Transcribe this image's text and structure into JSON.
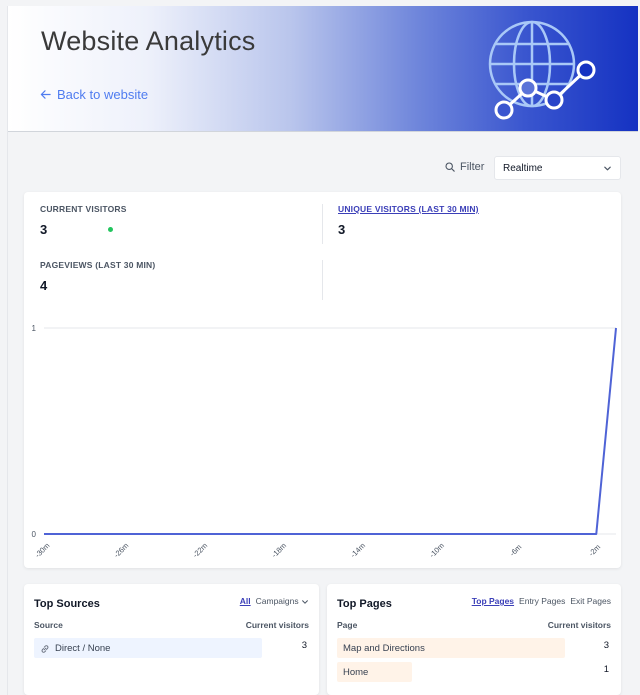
{
  "header": {
    "title": "Website Analytics",
    "back_link": "Back to website"
  },
  "controls": {
    "filter_label": "Filter",
    "period_selected": "Realtime"
  },
  "stats": [
    {
      "label": "CURRENT VISITORS",
      "value": "3",
      "selected": false
    },
    {
      "label": "UNIQUE VISITORS (LAST 30 MIN)",
      "value": "3",
      "selected": true
    },
    {
      "label": "PAGEVIEWS (LAST 30 MIN)",
      "value": "4",
      "selected": false
    }
  ],
  "chart_data": {
    "type": "line",
    "x": [
      -30,
      -29,
      -28,
      -27,
      -26,
      -25,
      -24,
      -23,
      -22,
      -21,
      -20,
      -19,
      -18,
      -17,
      -16,
      -15,
      -14,
      -13,
      -12,
      -11,
      -10,
      -9,
      -8,
      -7,
      -6,
      -5,
      -4,
      -3,
      -2,
      -1
    ],
    "x_tick_labels": [
      "-30m",
      "-26m",
      "-22m",
      "-18m",
      "-14m",
      "-10m",
      "-6m",
      "-2m"
    ],
    "series": [
      {
        "values": [
          0,
          0,
          0,
          0,
          0,
          0,
          0,
          0,
          0,
          0,
          0,
          0,
          0,
          0,
          0,
          0,
          0,
          0,
          0,
          0,
          0,
          0,
          0,
          0,
          0,
          0,
          0,
          0,
          0,
          1
        ]
      }
    ],
    "y_tick_labels": [
      "0",
      "1"
    ],
    "ylim": [
      0,
      1
    ],
    "grid": true,
    "colors": {
      "line": "#4f63d6"
    }
  },
  "top_sources": {
    "title": "Top Sources",
    "tabs": [
      "All",
      "Campaigns"
    ],
    "active_tab": "All",
    "col_left": "Source",
    "col_right": "Current visitors",
    "rows": [
      {
        "label": "Direct / None",
        "value": "3",
        "fraction": 1.0
      }
    ],
    "bar_color": "#eef4ff"
  },
  "top_pages": {
    "title": "Top Pages",
    "tabs": [
      "Top Pages",
      "Entry Pages",
      "Exit Pages"
    ],
    "active_tab": "Top Pages",
    "col_left": "Page",
    "col_right": "Current visitors",
    "rows": [
      {
        "label": "Map and Directions",
        "value": "3",
        "fraction": 1.0
      },
      {
        "label": "Home",
        "value": "1",
        "fraction": 0.33
      }
    ],
    "bar_color": "#fff3e8"
  }
}
